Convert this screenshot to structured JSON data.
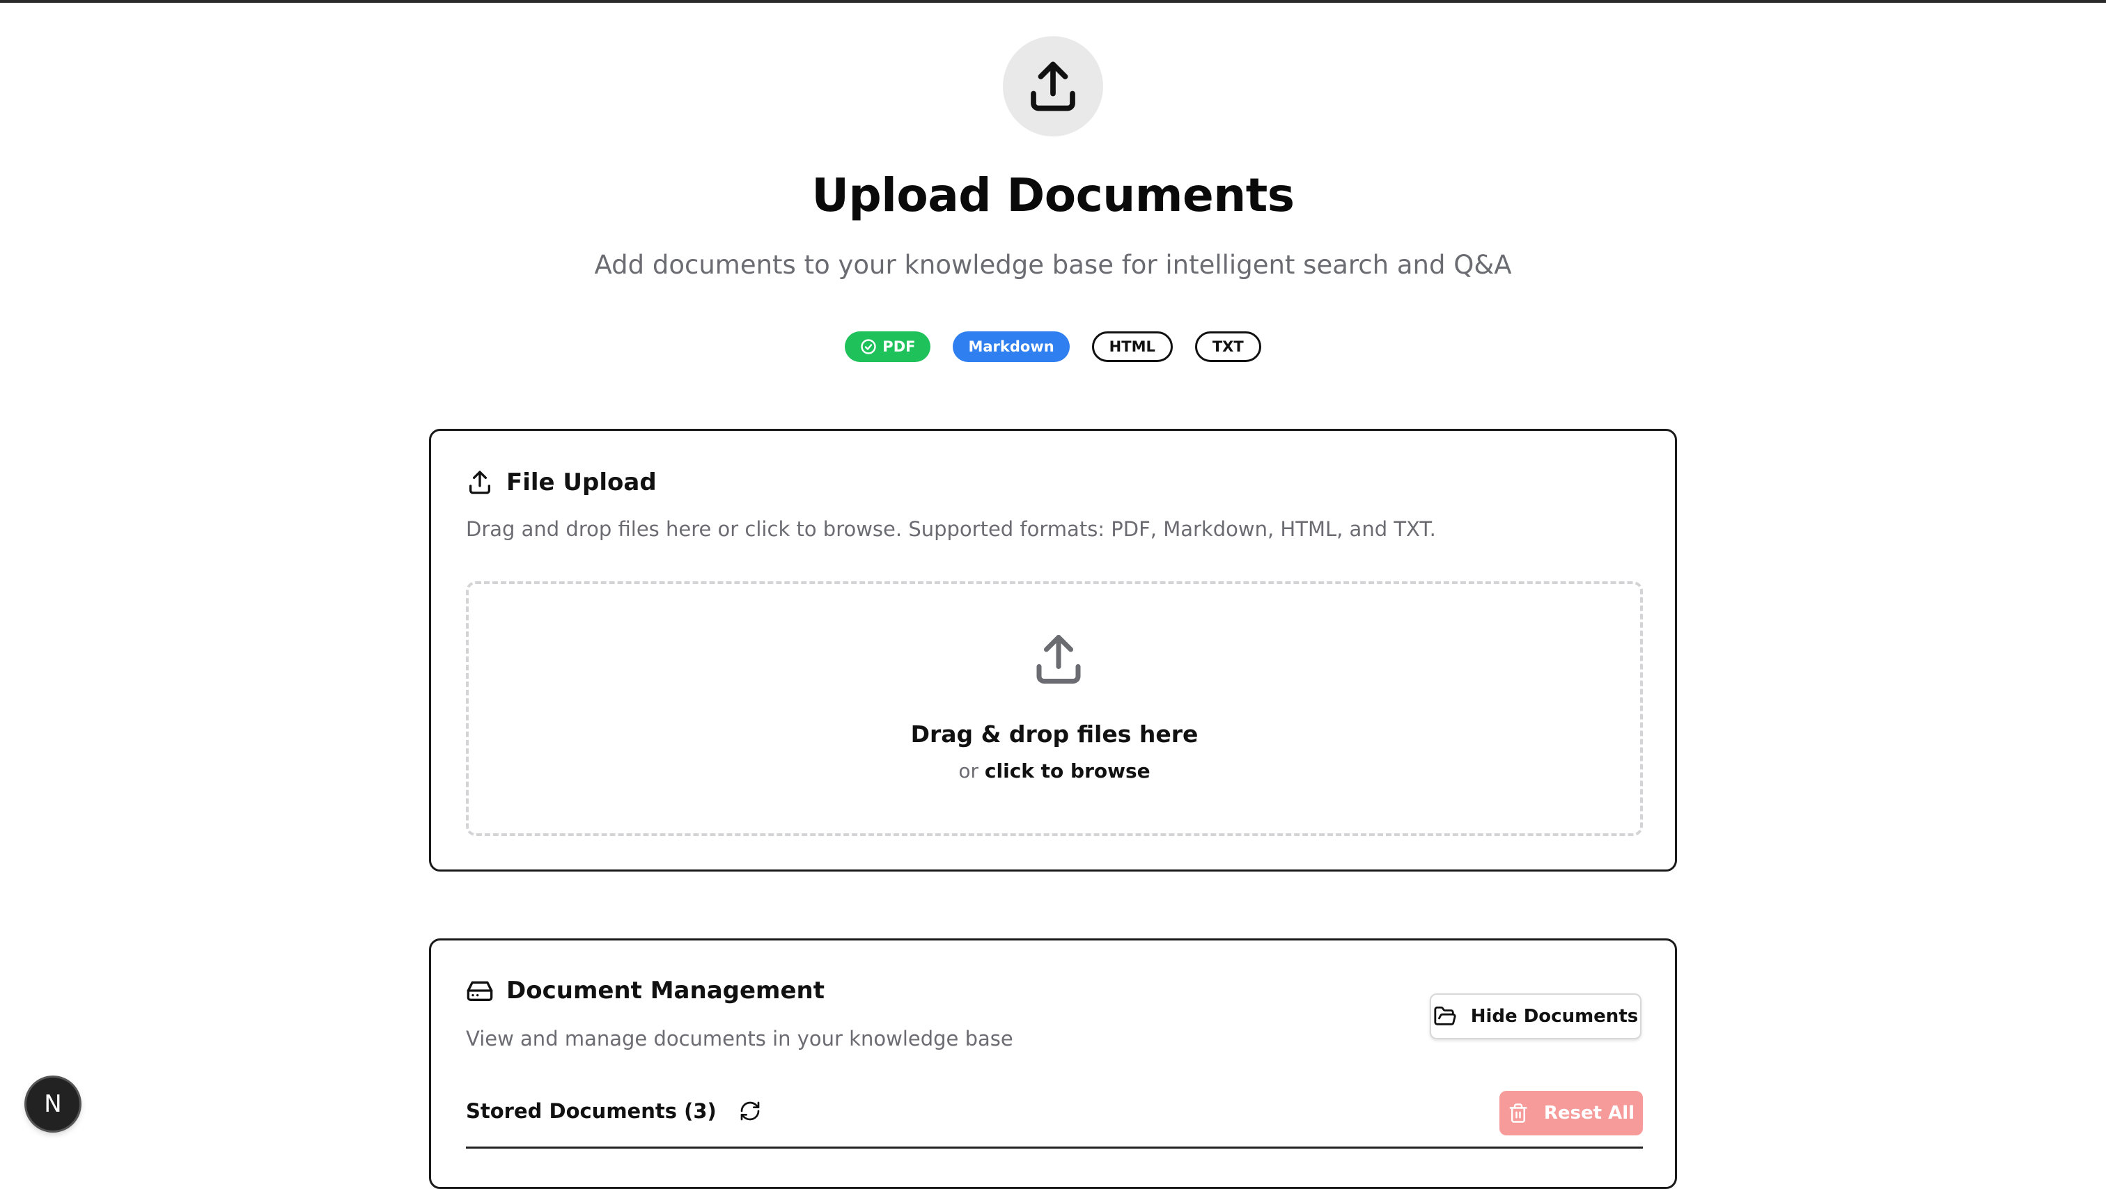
{
  "hero": {
    "icon": "upload-icon",
    "title": "Upload Documents",
    "subtitle": "Add documents to your knowledge base for intelligent search and Q&A"
  },
  "formats": [
    {
      "label": "PDF",
      "style": "green",
      "icon": "check-circle-icon"
    },
    {
      "label": "Markdown",
      "style": "blue"
    },
    {
      "label": "HTML",
      "style": "outline"
    },
    {
      "label": "TXT",
      "style": "outline"
    }
  ],
  "upload_card": {
    "icon": "upload-icon",
    "title": "File Upload",
    "description": "Drag and drop files here or click to browse. Supported formats: PDF, Markdown, HTML, and TXT.",
    "dropzone": {
      "icon": "upload-icon",
      "title": "Drag & drop files here",
      "sub_prefix": "or",
      "sub_action": "click to browse"
    }
  },
  "docs_card": {
    "icon": "hard-drive-icon",
    "title": "Document Management",
    "description": "View and manage documents in your knowledge base",
    "hide_button": {
      "label": "Hide Documents",
      "icon": "folder-open-icon"
    },
    "stored_label": "Stored Documents (3)",
    "refresh_icon": "refresh-icon",
    "reset_button": {
      "label": "Reset All",
      "icon": "trash-icon"
    }
  },
  "nav_badge": {
    "letter": "N"
  },
  "colors": {
    "pdf_badge": "#1fc15a",
    "markdown_badge": "#2f7ff0",
    "reset_button": "#f69a9a",
    "muted_text": "#6b6b72"
  }
}
